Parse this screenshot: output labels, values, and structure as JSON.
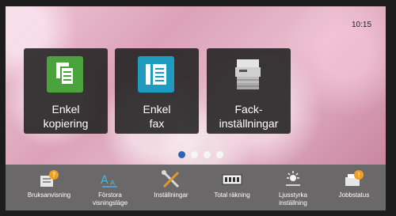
{
  "status": {
    "time": "10:15"
  },
  "tiles": [
    {
      "label_line1": "Enkel",
      "label_line2": "kopiering",
      "icon": "copy-icon",
      "color": "#4aa33c"
    },
    {
      "label_line1": "Enkel",
      "label_line2": "fax",
      "icon": "fax-icon",
      "color": "#1f9bc0"
    },
    {
      "label_line1": "Fack-",
      "label_line2": "inställningar",
      "icon": "printer-tray-icon",
      "color": "#cfcfcf"
    }
  ],
  "pager": {
    "pages": 4,
    "active": 1
  },
  "bottom_bar": [
    {
      "label_line1": "Bruksanvisning",
      "label_line2": "",
      "icon": "manual-icon"
    },
    {
      "label_line1": "Förstora",
      "label_line2": "visningsläge",
      "icon": "enlarge-display-icon"
    },
    {
      "label_line1": "Inställningar",
      "label_line2": "",
      "icon": "settings-tools-icon"
    },
    {
      "label_line1": "Total räkning",
      "label_line2": "",
      "icon": "counter-icon"
    },
    {
      "label_line1": "Ljusstyrka",
      "label_line2": "inställning",
      "icon": "brightness-icon"
    },
    {
      "label_line1": "Jobbstatus",
      "label_line2": "",
      "icon": "job-status-icon"
    }
  ],
  "colors": {
    "accent": "#2b63b8",
    "bar": "#6a6868",
    "tile_bg": "#202020"
  }
}
